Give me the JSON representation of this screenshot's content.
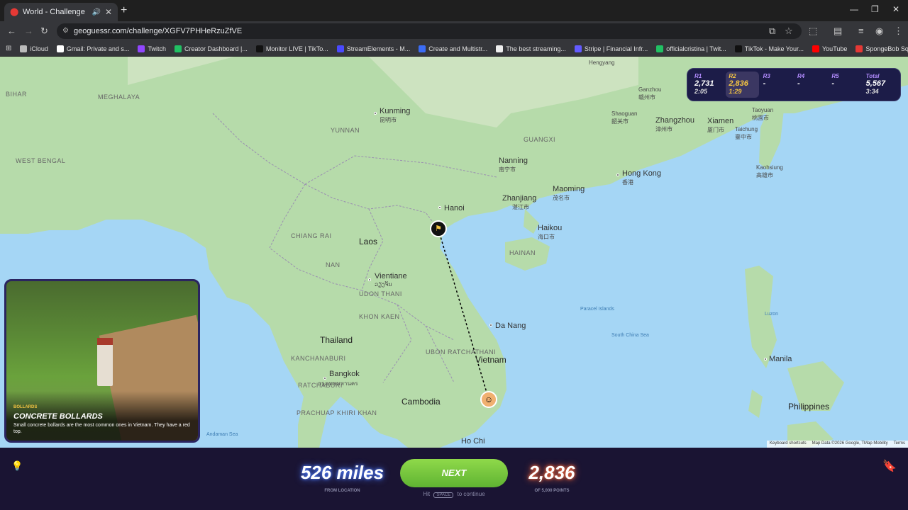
{
  "browser": {
    "tab_title": "World - Challenge - GeoGu...",
    "url": "geoguessr.com/challenge/XGFV7PHHeRzuZfVE",
    "bookmarks": [
      {
        "label": "iCloud",
        "color": "#bbbbbb"
      },
      {
        "label": "Gmail: Private and s...",
        "color": "#ffffff"
      },
      {
        "label": "Twitch",
        "color": "#9146ff"
      },
      {
        "label": "Creator Dashboard |...",
        "color": "#21c063"
      },
      {
        "label": "Monitor LIVE | TikTo...",
        "color": "#111111"
      },
      {
        "label": "StreamElements - M...",
        "color": "#4a4aff"
      },
      {
        "label": "Create and Multistr...",
        "color": "#3b6cf5"
      },
      {
        "label": "The best streaming...",
        "color": "#eeeeee"
      },
      {
        "label": "Stripe | Financial Infr...",
        "color": "#635bff"
      },
      {
        "label": "officialcristina | Twit...",
        "color": "#21c063"
      },
      {
        "label": "TikTok - Make Your...",
        "color": "#111111"
      },
      {
        "label": "YouTube",
        "color": "#ff0000"
      },
      {
        "label": "SpongeBob Square...",
        "color": "#e53935"
      }
    ]
  },
  "rounds": [
    {
      "label": "R1",
      "points": "2,731",
      "time": "2:05"
    },
    {
      "label": "R2",
      "points": "2,836",
      "time": "1:29"
    },
    {
      "label": "R3",
      "points": "-",
      "time": ""
    },
    {
      "label": "R4",
      "points": "-",
      "time": ""
    },
    {
      "label": "R5",
      "points": "-",
      "time": ""
    }
  ],
  "total": {
    "label": "Total",
    "points": "5,567",
    "time": "3:34"
  },
  "hint": {
    "category": "BOLLARDS",
    "title": "CONCRETE BOLLARDS",
    "description": "Small concrete bollards are the most common ones in Vietnam. They have a red top."
  },
  "result": {
    "distance": "526 miles",
    "distance_sub": "FROM LOCATION",
    "next_label": "NEXT",
    "continue_hit": "Hit",
    "continue_key": "SPACE",
    "continue_rest": "to continue",
    "points": "2,836",
    "points_sub": "OF 5,000 POINTS"
  },
  "map": {
    "attribution": [
      "Keyboard shortcuts",
      "Map Data ©2026 Google, TMap Mobility",
      "Terms"
    ],
    "countries": [
      {
        "name": "Laos"
      },
      {
        "name": "Thailand"
      },
      {
        "name": "Vietnam"
      },
      {
        "name": "Cambodia"
      },
      {
        "name": "Philippines"
      }
    ],
    "cities": [
      {
        "name": "Kunming",
        "sub": "昆明市"
      },
      {
        "name": "Hanoi",
        "sub": ""
      },
      {
        "name": "Nanning",
        "sub": "南宁市"
      },
      {
        "name": "Zhanjiang",
        "sub": "湛江市"
      },
      {
        "name": "Maoming",
        "sub": "茂名市"
      },
      {
        "name": "Hong Kong",
        "sub": "香港"
      },
      {
        "name": "Haikou",
        "sub": "海口市"
      },
      {
        "name": "Zhangzhou",
        "sub": "漳州市"
      },
      {
        "name": "Xiamen",
        "sub": "厦门市"
      },
      {
        "name": "Vientiane",
        "sub": "ວຽງຈັນ"
      },
      {
        "name": "Da Nang",
        "sub": ""
      },
      {
        "name": "Bangkok",
        "sub": "กรุงเทพมหานคร"
      },
      {
        "name": "Ho Chi",
        "sub": ""
      },
      {
        "name": "Manila",
        "sub": ""
      },
      {
        "name": "Hengyang",
        "sub": ""
      },
      {
        "name": "Shaoguan",
        "sub": "韶关市"
      },
      {
        "name": "Ganzhou",
        "sub": "赣州市"
      },
      {
        "name": "Kaohsiung",
        "sub": "高雄市"
      },
      {
        "name": "Taichung",
        "sub": "臺中市"
      },
      {
        "name": "Taoyuan",
        "sub": "桃園市"
      }
    ],
    "regions": [
      {
        "name": "YUNNAN"
      },
      {
        "name": "GUANGXI"
      },
      {
        "name": "HAINAN"
      },
      {
        "name": "MEGHALAYA"
      },
      {
        "name": "WEST BENGAL"
      },
      {
        "name": "BIHAR"
      },
      {
        "name": "NAN"
      },
      {
        "name": "KHON KAEN"
      },
      {
        "name": "UDON THANI"
      },
      {
        "name": "KANCHANABURI"
      },
      {
        "name": "RATCHABURI"
      },
      {
        "name": "PRACHUAP KHIRI KHAN"
      },
      {
        "name": "CHIANG RAI"
      },
      {
        "name": "UBON RATCHATHANI"
      }
    ],
    "seas": [
      {
        "name": "South China Sea"
      },
      {
        "name": "Andaman Sea"
      },
      {
        "name": "Paracel Islands"
      },
      {
        "name": "Luzon"
      }
    ]
  }
}
